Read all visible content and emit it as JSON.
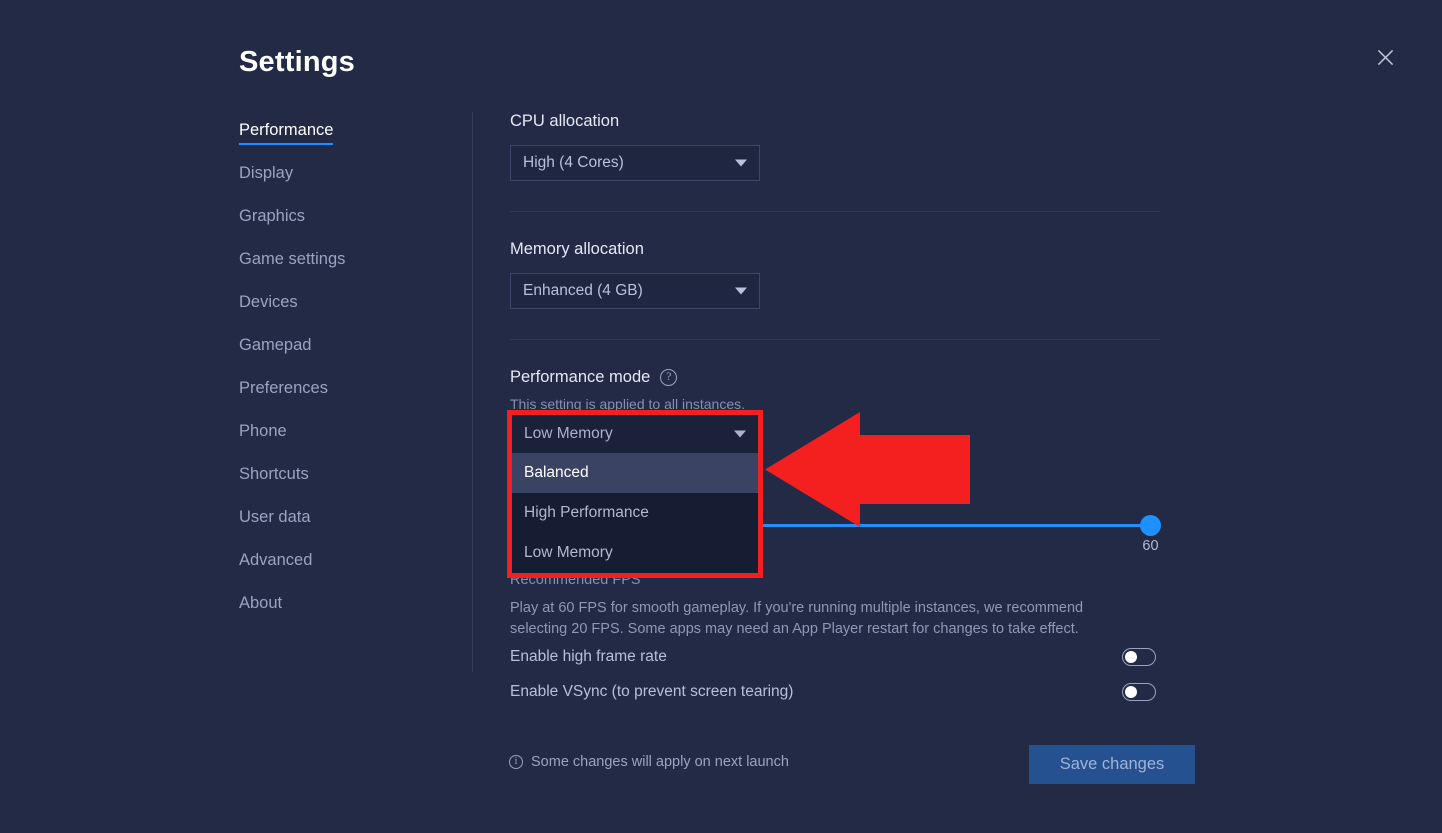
{
  "window": {
    "title": "Settings",
    "close_icon": "close-icon"
  },
  "sidebar": {
    "items": [
      {
        "label": "Performance",
        "active": true
      },
      {
        "label": "Display",
        "active": false
      },
      {
        "label": "Graphics",
        "active": false
      },
      {
        "label": "Game settings",
        "active": false
      },
      {
        "label": "Devices",
        "active": false
      },
      {
        "label": "Gamepad",
        "active": false
      },
      {
        "label": "Preferences",
        "active": false
      },
      {
        "label": "Phone",
        "active": false
      },
      {
        "label": "Shortcuts",
        "active": false
      },
      {
        "label": "User data",
        "active": false
      },
      {
        "label": "Advanced",
        "active": false
      },
      {
        "label": "About",
        "active": false
      }
    ]
  },
  "main": {
    "cpu": {
      "label": "CPU allocation",
      "value": "High (4 Cores)",
      "caret_icon": "chevron-down-icon"
    },
    "memory": {
      "label": "Memory allocation",
      "value": "Enhanced (4 GB)",
      "caret_icon": "chevron-down-icon"
    },
    "performance_mode": {
      "label": "Performance mode",
      "help_icon": "question-mark-icon",
      "help_glyph": "?",
      "sublabel": "This setting is applied to all instances.",
      "selected": "Low Memory",
      "caret_icon": "chevron-down-icon",
      "expanded": true,
      "options": [
        {
          "label": "Balanced",
          "highlighted": true
        },
        {
          "label": "High Performance",
          "highlighted": false
        },
        {
          "label": "Low Memory",
          "highlighted": false
        }
      ]
    },
    "fps": {
      "slider_value": "60",
      "slider_min": 0,
      "slider_max": 60,
      "title": "Recommended FPS",
      "description": "Play at 60 FPS for smooth gameplay. If you're running multiple instances, we recommend selecting 20 FPS. Some apps may need an App Player restart for changes to take effect."
    },
    "toggles": [
      {
        "label": "Enable high frame rate",
        "on": false
      },
      {
        "label": "Enable VSync (to prevent screen tearing)",
        "on": false
      }
    ]
  },
  "footer": {
    "info_icon": "info-icon",
    "info_glyph": "i",
    "note": "Some changes will apply on next launch",
    "save_label": "Save changes"
  },
  "annotation": {
    "arrow_icon": "left-arrow-annotation",
    "arrow_color": "#f41f1f",
    "highlight_color": "#f41f1f"
  },
  "colors": {
    "background": "#222a46",
    "accent": "#1e90ff",
    "save_button": "#255191"
  }
}
